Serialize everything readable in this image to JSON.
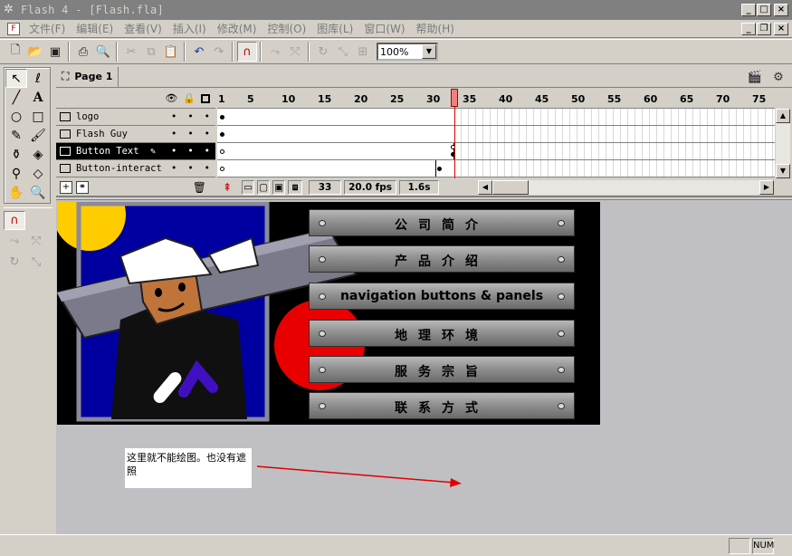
{
  "window": {
    "title": "Flash 4 - [Flash.fla]",
    "min": "_",
    "max": "□",
    "close": "×"
  },
  "menu": [
    "文件(F)",
    "编辑(E)",
    "查看(V)",
    "插入(I)",
    "修改(M)",
    "控制(O)",
    "图库(L)",
    "窗口(W)",
    "帮助(H)"
  ],
  "toolbar": {
    "zoom": "100%"
  },
  "scene": {
    "tab": "Page 1"
  },
  "timeline": {
    "ruler": [
      "1",
      "5",
      "10",
      "15",
      "20",
      "25",
      "30",
      "35",
      "40",
      "45",
      "50",
      "55",
      "60",
      "65",
      "70",
      "75"
    ],
    "layers": [
      {
        "name": "logo"
      },
      {
        "name": "Flash Guy"
      },
      {
        "name": "Button Text"
      },
      {
        "name": "Button-interacti"
      }
    ],
    "current_frame": "33",
    "fps": "20.0 fps",
    "elapsed": "1.6s"
  },
  "stage": {
    "buttons": [
      "公司简介",
      "产品介绍",
      "navigation buttons & panels",
      "地理环境",
      "服务宗旨",
      "联系方式"
    ],
    "note": "这里就不能绘图。也没有遮照"
  },
  "status": {
    "num": "NUM"
  },
  "colors": {
    "highlight": "#000000",
    "playhead": "#f08080",
    "arrow": "#e00000"
  }
}
